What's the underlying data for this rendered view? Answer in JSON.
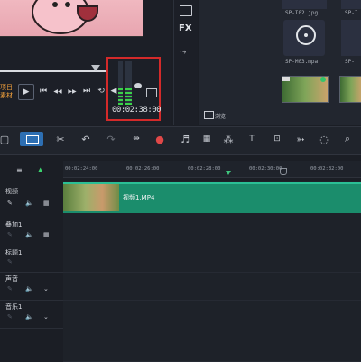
{
  "preview": {
    "project_label_1": "项目",
    "project_label_2": "素材",
    "timecode": "00:02:38:00",
    "play_icon": "▶",
    "prev_icon": "⏮",
    "step_back_icon": "◀◀",
    "step_fwd_icon": "▶▶",
    "next_icon": "⏭",
    "repeat_icon": "⟲",
    "volume_icon": "◀",
    "aspect_icon": "aspect-ratio-icon"
  },
  "side_tools": {
    "fx_label": "FX",
    "icons": [
      "media-icon",
      "fx-icon",
      "path-icon"
    ]
  },
  "library": {
    "thumbs": [
      {
        "label": "SP-I02.jpg"
      },
      {
        "label": "SP-I"
      },
      {
        "label": "SP-M03.mpa"
      },
      {
        "label": "SP-"
      }
    ],
    "browse_label": "浏览"
  },
  "toolbar": {
    "icons": [
      "storyboard-view-icon",
      "timeline-view-icon",
      "tools-icon",
      "undo-icon",
      "redo-icon",
      "split-icon",
      "record-icon",
      "audio-mixer-icon",
      "auto-music-icon",
      "motion-icon",
      "title-icon",
      "crop-icon",
      "track-motion-icon",
      "mask-icon",
      "zoom-icon"
    ]
  },
  "ruler": {
    "labels": [
      "00:02:24:00",
      "00:02:26:00",
      "00:02:28:00",
      "00:02:30:00",
      "00:02:32:00"
    ]
  },
  "tracks": [
    {
      "name": "视频",
      "clip": "视频1.MP4"
    },
    {
      "name": "叠加1"
    },
    {
      "name": "标题1"
    },
    {
      "name": "声音"
    },
    {
      "name": "音乐1"
    }
  ],
  "colors": {
    "accent": "#2d6fb3",
    "clip": "#1b8d6c",
    "highlight_box": "#d42a2a",
    "vu_green": "#3bd34a",
    "project_label": "#f3a13b"
  }
}
